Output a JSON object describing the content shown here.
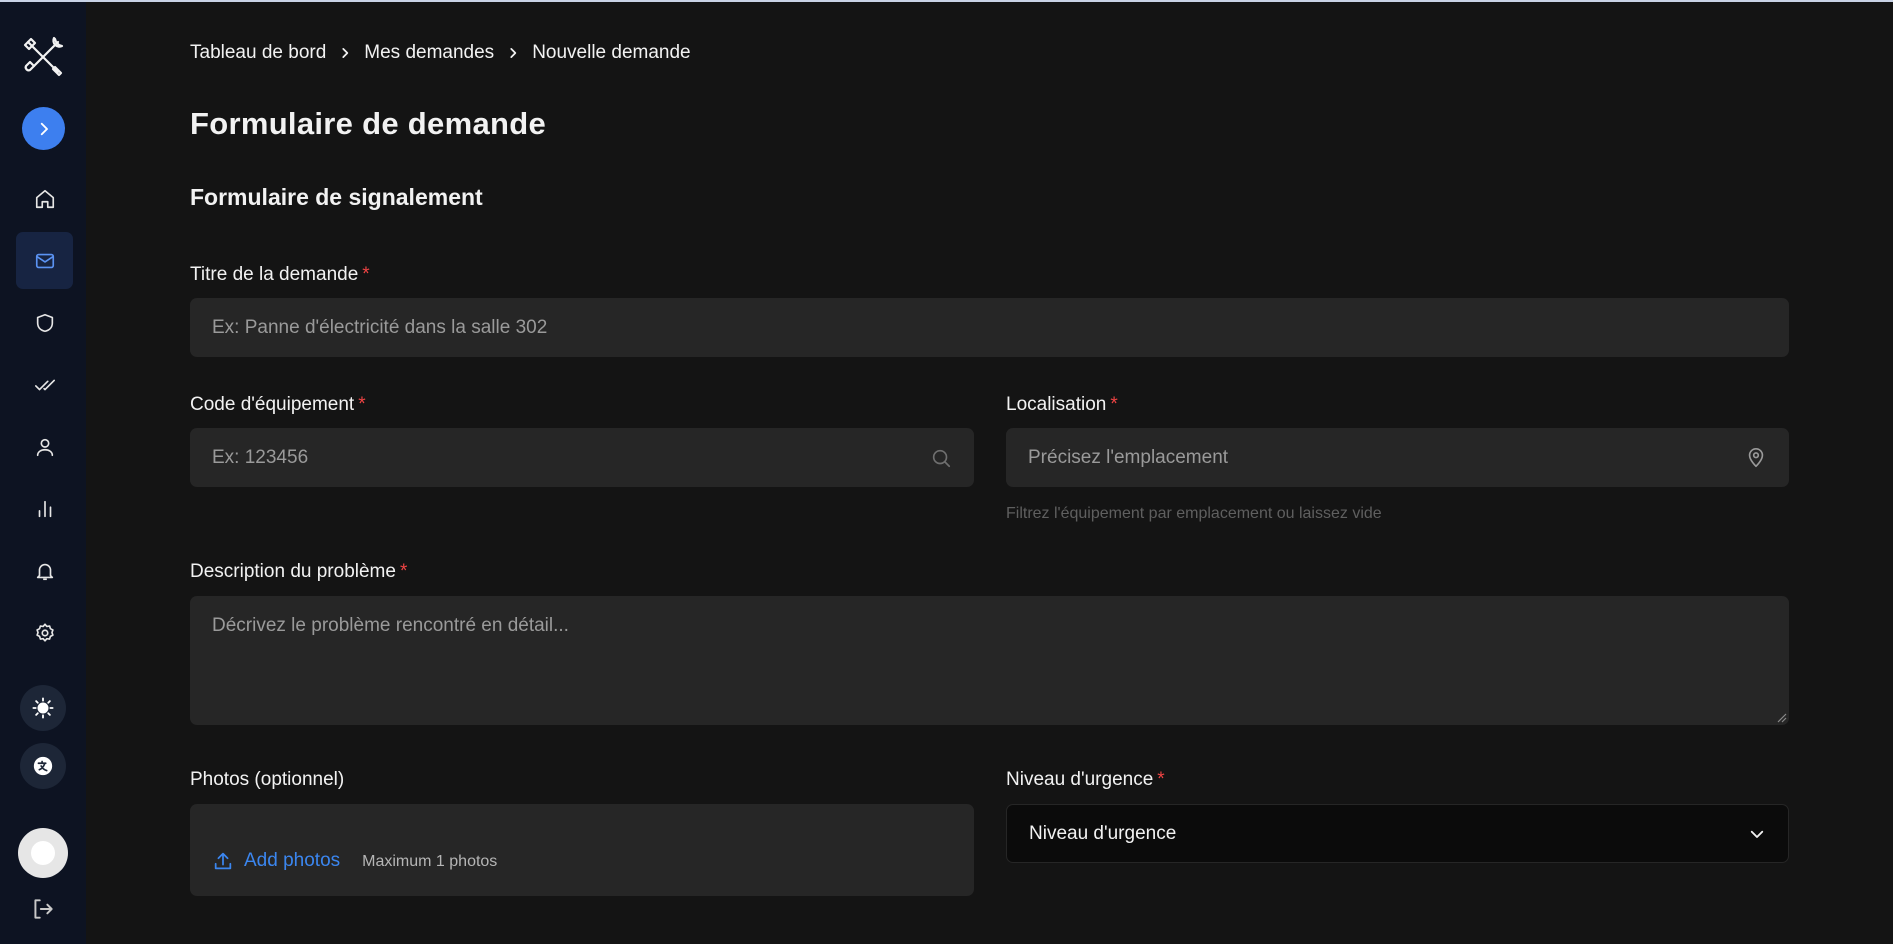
{
  "breadcrumb": {
    "items": [
      "Tableau de bord",
      "Mes demandes",
      "Nouvelle demande"
    ]
  },
  "page_title": "Formulaire de demande",
  "section_title": "Formulaire de signalement",
  "form": {
    "title": {
      "label": "Titre de la demande",
      "required_mark": "*",
      "placeholder": "Ex: Panne d'électricité dans la salle 302"
    },
    "equipment_code": {
      "label": "Code d'équipement",
      "required_mark": "*",
      "placeholder": "Ex: 123456"
    },
    "location": {
      "label": "Localisation",
      "required_mark": "*",
      "placeholder": "Précisez l'emplacement",
      "hint": "Filtrez l'équipement par emplacement ou laissez vide"
    },
    "description": {
      "label": "Description du problème",
      "required_mark": "*",
      "placeholder": "Décrivez le problème rencontré en détail..."
    },
    "photos": {
      "label": "Photos (optionnel)",
      "add_label": "Add photos",
      "max_label": "Maximum 1 photos"
    },
    "urgency": {
      "label": "Niveau d'urgence",
      "required_mark": "*",
      "selected": "Niveau d'urgence"
    }
  },
  "sidebar": {
    "items": [
      {
        "icon": "home-icon"
      },
      {
        "icon": "mail-icon",
        "active": true
      },
      {
        "icon": "shield-icon"
      },
      {
        "icon": "double-check-icon"
      },
      {
        "icon": "user-icon"
      },
      {
        "icon": "bar-chart-icon"
      },
      {
        "icon": "bell-icon"
      },
      {
        "icon": "gear-icon"
      }
    ]
  },
  "colors": {
    "accent": "#3d7fef",
    "required": "#ef4444",
    "sidebar_bg": "#0d1322",
    "page_bg": "#141414",
    "field_bg": "#262626"
  }
}
